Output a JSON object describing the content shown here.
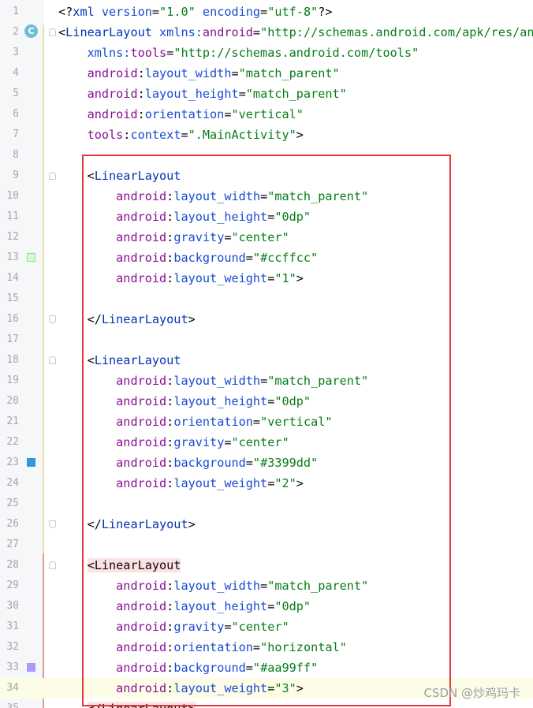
{
  "colors": {
    "tag": "#0033b3",
    "attr_namespace": "#871094",
    "attr_name": "#174ad4",
    "attr_value": "#067d17",
    "highlight_box": "#e0393e",
    "swatch_1": "#ccffcc",
    "swatch_2": "#3399dd",
    "swatch_3": "#aa99ff"
  },
  "gutter": {
    "class_icon_letter": "C"
  },
  "lines": [
    {
      "n": "1",
      "tokens": [
        [
          "punct",
          "<?"
        ],
        [
          "tag",
          "xml "
        ],
        [
          "attr-name",
          "version"
        ],
        [
          "punct",
          "="
        ],
        [
          "attr-val",
          "\"1.0\""
        ],
        [
          "punct",
          " "
        ],
        [
          "attr-name",
          "encoding"
        ],
        [
          "punct",
          "="
        ],
        [
          "attr-val",
          "\"utf-8\""
        ],
        [
          "punct",
          "?>"
        ]
      ]
    },
    {
      "n": "2",
      "tokens": [
        [
          "punct",
          "<"
        ],
        [
          "tag",
          "LinearLayout "
        ],
        [
          "attr-name",
          "xmlns:"
        ],
        [
          "attr-ns",
          "android"
        ],
        [
          "punct",
          "="
        ],
        [
          "attr-val",
          "\"http://schemas.android.com/apk/res/and"
        ]
      ]
    },
    {
      "n": "3",
      "tokens": [
        [
          "punct",
          "    "
        ],
        [
          "attr-name",
          "xmlns:"
        ],
        [
          "attr-ns",
          "tools"
        ],
        [
          "punct",
          "="
        ],
        [
          "attr-val",
          "\"http://schemas.android.com/tools\""
        ]
      ]
    },
    {
      "n": "4",
      "tokens": [
        [
          "punct",
          "    "
        ],
        [
          "attr-ns",
          "android"
        ],
        [
          "punct",
          ":"
        ],
        [
          "attr-name",
          "layout_width"
        ],
        [
          "punct",
          "="
        ],
        [
          "attr-val",
          "\"match_parent\""
        ]
      ]
    },
    {
      "n": "5",
      "tokens": [
        [
          "punct",
          "    "
        ],
        [
          "attr-ns",
          "android"
        ],
        [
          "punct",
          ":"
        ],
        [
          "attr-name",
          "layout_height"
        ],
        [
          "punct",
          "="
        ],
        [
          "attr-val",
          "\"match_parent\""
        ]
      ]
    },
    {
      "n": "6",
      "tokens": [
        [
          "punct",
          "    "
        ],
        [
          "attr-ns",
          "android"
        ],
        [
          "punct",
          ":"
        ],
        [
          "attr-name",
          "orientation"
        ],
        [
          "punct",
          "="
        ],
        [
          "attr-val",
          "\"vertical\""
        ]
      ]
    },
    {
      "n": "7",
      "tokens": [
        [
          "punct",
          "    "
        ],
        [
          "attr-ns",
          "tools"
        ],
        [
          "punct",
          ":"
        ],
        [
          "attr-name",
          "context"
        ],
        [
          "punct",
          "="
        ],
        [
          "attr-val",
          "\".MainActivity\""
        ],
        [
          "punct",
          ">"
        ]
      ]
    },
    {
      "n": "8",
      "tokens": []
    },
    {
      "n": "9",
      "tokens": [
        [
          "punct",
          "    <"
        ],
        [
          "tag",
          "LinearLayout"
        ]
      ]
    },
    {
      "n": "10",
      "tokens": [
        [
          "punct",
          "        "
        ],
        [
          "attr-ns",
          "android"
        ],
        [
          "punct",
          ":"
        ],
        [
          "attr-name",
          "layout_width"
        ],
        [
          "punct",
          "="
        ],
        [
          "attr-val",
          "\"match_parent\""
        ]
      ]
    },
    {
      "n": "11",
      "tokens": [
        [
          "punct",
          "        "
        ],
        [
          "attr-ns",
          "android"
        ],
        [
          "punct",
          ":"
        ],
        [
          "attr-name",
          "layout_height"
        ],
        [
          "punct",
          "="
        ],
        [
          "attr-val",
          "\"0dp\""
        ]
      ]
    },
    {
      "n": "12",
      "tokens": [
        [
          "punct",
          "        "
        ],
        [
          "attr-ns",
          "android"
        ],
        [
          "punct",
          ":"
        ],
        [
          "attr-name",
          "gravity"
        ],
        [
          "punct",
          "="
        ],
        [
          "attr-val",
          "\"center\""
        ]
      ]
    },
    {
      "n": "13",
      "tokens": [
        [
          "punct",
          "        "
        ],
        [
          "attr-ns",
          "android"
        ],
        [
          "punct",
          ":"
        ],
        [
          "attr-name",
          "background"
        ],
        [
          "punct",
          "="
        ],
        [
          "attr-val",
          "\"#ccffcc\""
        ]
      ]
    },
    {
      "n": "14",
      "tokens": [
        [
          "punct",
          "        "
        ],
        [
          "attr-ns",
          "android"
        ],
        [
          "punct",
          ":"
        ],
        [
          "attr-name",
          "layout_weight"
        ],
        [
          "punct",
          "="
        ],
        [
          "attr-val",
          "\"1\""
        ],
        [
          "punct",
          ">"
        ]
      ]
    },
    {
      "n": "15",
      "tokens": []
    },
    {
      "n": "16",
      "tokens": [
        [
          "punct",
          "    </"
        ],
        [
          "tag",
          "LinearLayout"
        ],
        [
          "punct",
          ">"
        ]
      ]
    },
    {
      "n": "17",
      "tokens": []
    },
    {
      "n": "18",
      "tokens": [
        [
          "punct",
          "    <"
        ],
        [
          "tag",
          "LinearLayout"
        ]
      ]
    },
    {
      "n": "19",
      "tokens": [
        [
          "punct",
          "        "
        ],
        [
          "attr-ns",
          "android"
        ],
        [
          "punct",
          ":"
        ],
        [
          "attr-name",
          "layout_width"
        ],
        [
          "punct",
          "="
        ],
        [
          "attr-val",
          "\"match_parent\""
        ]
      ]
    },
    {
      "n": "20",
      "tokens": [
        [
          "punct",
          "        "
        ],
        [
          "attr-ns",
          "android"
        ],
        [
          "punct",
          ":"
        ],
        [
          "attr-name",
          "layout_height"
        ],
        [
          "punct",
          "="
        ],
        [
          "attr-val",
          "\"0dp\""
        ]
      ]
    },
    {
      "n": "21",
      "tokens": [
        [
          "punct",
          "        "
        ],
        [
          "attr-ns",
          "android"
        ],
        [
          "punct",
          ":"
        ],
        [
          "attr-name",
          "orientation"
        ],
        [
          "punct",
          "="
        ],
        [
          "attr-val",
          "\"vertical\""
        ]
      ]
    },
    {
      "n": "22",
      "tokens": [
        [
          "punct",
          "        "
        ],
        [
          "attr-ns",
          "android"
        ],
        [
          "punct",
          ":"
        ],
        [
          "attr-name",
          "gravity"
        ],
        [
          "punct",
          "="
        ],
        [
          "attr-val",
          "\"center\""
        ]
      ]
    },
    {
      "n": "23",
      "tokens": [
        [
          "punct",
          "        "
        ],
        [
          "attr-ns",
          "android"
        ],
        [
          "punct",
          ":"
        ],
        [
          "attr-name",
          "background"
        ],
        [
          "punct",
          "="
        ],
        [
          "attr-val",
          "\"#3399dd\""
        ]
      ]
    },
    {
      "n": "24",
      "tokens": [
        [
          "punct",
          "        "
        ],
        [
          "attr-ns",
          "android"
        ],
        [
          "punct",
          ":"
        ],
        [
          "attr-name",
          "layout_weight"
        ],
        [
          "punct",
          "="
        ],
        [
          "attr-val",
          "\"2\""
        ],
        [
          "punct",
          ">"
        ]
      ]
    },
    {
      "n": "25",
      "tokens": []
    },
    {
      "n": "26",
      "tokens": [
        [
          "punct",
          "    </"
        ],
        [
          "tag",
          "LinearLayout"
        ],
        [
          "punct",
          ">"
        ]
      ]
    },
    {
      "n": "27",
      "tokens": []
    },
    {
      "n": "28",
      "tokens": [
        [
          "punct",
          "    "
        ],
        [
          "tag-hl",
          "<LinearLayout"
        ]
      ]
    },
    {
      "n": "29",
      "tokens": [
        [
          "punct",
          "        "
        ],
        [
          "attr-ns",
          "android"
        ],
        [
          "punct",
          ":"
        ],
        [
          "attr-name",
          "layout_width"
        ],
        [
          "punct",
          "="
        ],
        [
          "attr-val",
          "\"match_parent\""
        ]
      ]
    },
    {
      "n": "30",
      "tokens": [
        [
          "punct",
          "        "
        ],
        [
          "attr-ns",
          "android"
        ],
        [
          "punct",
          ":"
        ],
        [
          "attr-name",
          "layout_height"
        ],
        [
          "punct",
          "="
        ],
        [
          "attr-val",
          "\"0dp\""
        ]
      ]
    },
    {
      "n": "31",
      "tokens": [
        [
          "punct",
          "        "
        ],
        [
          "attr-ns",
          "android"
        ],
        [
          "punct",
          ":"
        ],
        [
          "attr-name",
          "gravity"
        ],
        [
          "punct",
          "="
        ],
        [
          "attr-val",
          "\"center\""
        ]
      ]
    },
    {
      "n": "32",
      "tokens": [
        [
          "punct",
          "        "
        ],
        [
          "attr-ns",
          "android"
        ],
        [
          "punct",
          ":"
        ],
        [
          "attr-name",
          "orientation"
        ],
        [
          "punct",
          "="
        ],
        [
          "attr-val",
          "\"horizontal\""
        ]
      ]
    },
    {
      "n": "33",
      "tokens": [
        [
          "punct",
          "        "
        ],
        [
          "attr-ns",
          "android"
        ],
        [
          "punct",
          ":"
        ],
        [
          "attr-name",
          "background"
        ],
        [
          "punct",
          "="
        ],
        [
          "attr-val",
          "\"#aa99ff\""
        ]
      ]
    },
    {
      "n": "34",
      "tokens": [
        [
          "punct",
          "        "
        ],
        [
          "attr-ns",
          "android"
        ],
        [
          "punct",
          ":"
        ],
        [
          "attr-name",
          "layout_weight"
        ],
        [
          "punct",
          "="
        ],
        [
          "attr-val",
          "\"3\""
        ],
        [
          "punct",
          ">"
        ]
      ]
    },
    {
      "n": "35",
      "tokens": [
        [
          "punct",
          "    "
        ],
        [
          "tag-hl",
          "</LinearLayout>"
        ]
      ]
    }
  ],
  "watermark": "CSDN @炒鸡玛卡"
}
